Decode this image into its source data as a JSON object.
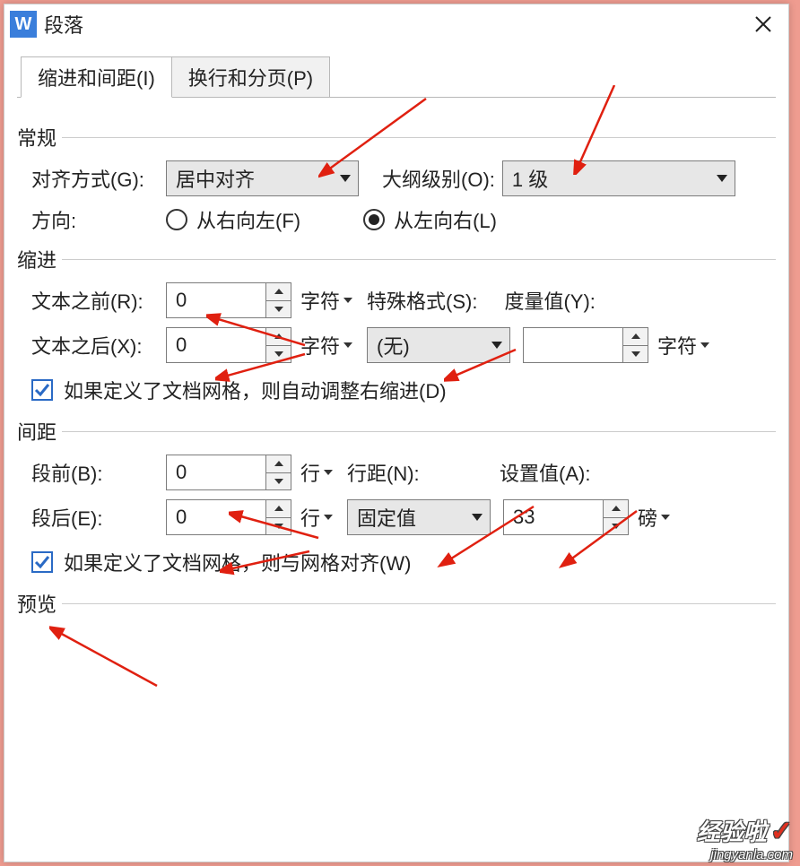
{
  "window": {
    "icon_letter": "W",
    "title": "段落"
  },
  "tabs": {
    "indent_spacing": "缩进和间距(I)",
    "line_page_break": "换行和分页(P)"
  },
  "groups": {
    "general": "常规",
    "indent": "缩进",
    "spacing": "间距",
    "preview": "预览"
  },
  "general": {
    "align_label": "对齐方式(G):",
    "align_value": "居中对齐",
    "outline_label": "大纲级别(O):",
    "outline_value": "1 级",
    "direction_label": "方向:",
    "rtl_label": "从右向左(F)",
    "ltr_label": "从左向右(L)"
  },
  "indent": {
    "before_label": "文本之前(R):",
    "before_value": "0",
    "before_unit": "字符",
    "after_label": "文本之后(X):",
    "after_value": "0",
    "after_unit": "字符",
    "special_label": "特殊格式(S):",
    "special_value": "(无)",
    "measure_label": "度量值(Y):",
    "measure_value": "",
    "measure_unit": "字符",
    "auto_adjust_label": "如果定义了文档网格，则自动调整右缩进(D)"
  },
  "spacing": {
    "before_label": "段前(B):",
    "before_value": "0",
    "before_unit": "行",
    "after_label": "段后(E):",
    "after_value": "0",
    "after_unit": "行",
    "line_label": "行距(N):",
    "line_value": "固定值",
    "set_label": "设置值(A):",
    "set_value": "33",
    "set_unit": "磅",
    "snap_label": "如果定义了文档网格，则与网格对齐(W)"
  },
  "watermark": {
    "big": "经验啦",
    "small": "jingyanla.com"
  }
}
